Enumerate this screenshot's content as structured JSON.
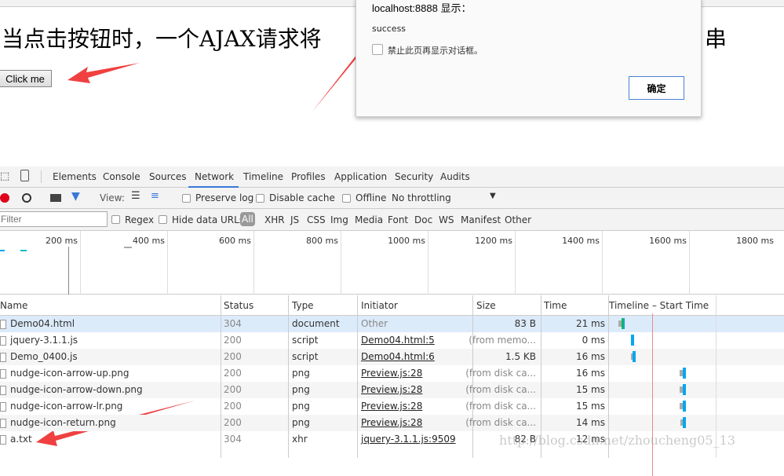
{
  "page": {
    "heading_left": "当点击按钮时，一个AJAX请求将",
    "heading_right": "串",
    "button": "Click me"
  },
  "dialog": {
    "title": "localhost:8888 显示：",
    "message": "success",
    "checkbox_label": "禁止此页再显示对话框。",
    "ok": "确定"
  },
  "devtools": {
    "tabs": [
      "Elements",
      "Console",
      "Sources",
      "Network",
      "Timeline",
      "Profiles",
      "Application",
      "Security",
      "Audits"
    ],
    "active_tab": "Network",
    "toolbar": {
      "view_label": "View:",
      "preserve_log": "Preserve log",
      "disable_cache": "Disable cache",
      "offline": "Offline",
      "throttling": "No throttling"
    },
    "filter": {
      "placeholder": "Filter",
      "regex": "Regex",
      "hide_data_urls": "Hide data URLs",
      "types": [
        "All",
        "XHR",
        "JS",
        "CSS",
        "Img",
        "Media",
        "Font",
        "Doc",
        "WS",
        "Manifest",
        "Other"
      ]
    },
    "overview_ticks": [
      "200 ms",
      "400 ms",
      "600 ms",
      "800 ms",
      "1000 ms",
      "1200 ms",
      "1400 ms",
      "1600 ms",
      "1800 ms"
    ],
    "columns": [
      "Name",
      "Status",
      "Type",
      "Initiator",
      "Size",
      "Time",
      "Timeline – Start Time"
    ],
    "rows": [
      {
        "name": "Demo04.html",
        "status": "304",
        "type": "document",
        "initiator": "Other",
        "size": "83 B",
        "time": "21 ms"
      },
      {
        "name": "jquery-3.1.1.js",
        "status": "200",
        "type": "script",
        "initiator": "Demo04.html:5",
        "size": "(from memo...",
        "time": "0 ms"
      },
      {
        "name": "Demo_0400.js",
        "status": "200",
        "type": "script",
        "initiator": "Demo04.html:6",
        "size": "1.5 KB",
        "time": "16 ms"
      },
      {
        "name": "nudge-icon-arrow-up.png",
        "status": "200",
        "type": "png",
        "initiator": "Preview.js:28",
        "size": "(from disk ca...",
        "time": "16 ms"
      },
      {
        "name": "nudge-icon-arrow-down.png",
        "status": "200",
        "type": "png",
        "initiator": "Preview.js:28",
        "size": "(from disk ca...",
        "time": "15 ms"
      },
      {
        "name": "nudge-icon-arrow-lr.png",
        "status": "200",
        "type": "png",
        "initiator": "Preview.js:28",
        "size": "(from disk ca...",
        "time": "15 ms"
      },
      {
        "name": "nudge-icon-return.png",
        "status": "200",
        "type": "png",
        "initiator": "Preview.js:28",
        "size": "(from disk ca...",
        "time": "14 ms"
      },
      {
        "name": "a.txt",
        "status": "304",
        "type": "xhr",
        "initiator": "jquery-3.1.1.js:9509",
        "size": "82 B",
        "time": "12 ms"
      }
    ]
  },
  "watermark": "http://blog.csdn.net/zhoucheng05_13",
  "colors": {
    "accent": "#3879d9",
    "record": "#e0001b",
    "bar": "#00a6f0",
    "selected_row": "#dcebfa",
    "arrow": "#f04040"
  }
}
